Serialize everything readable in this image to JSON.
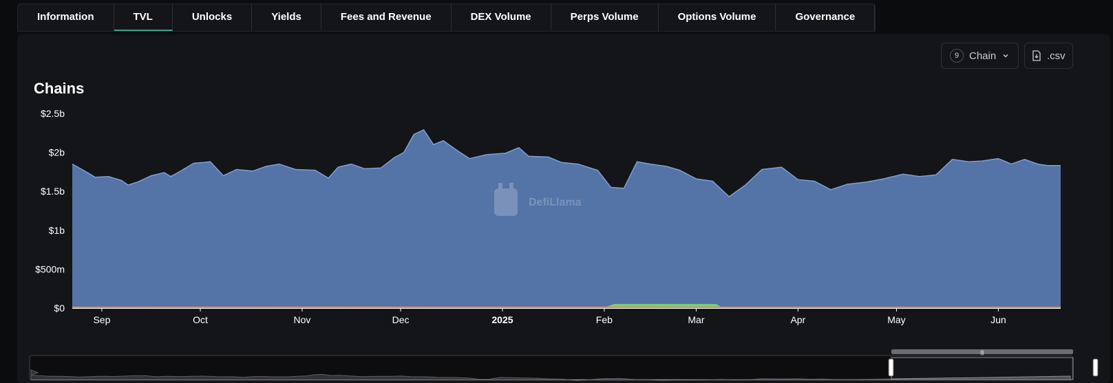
{
  "tabs": [
    {
      "label": "Information",
      "active": false
    },
    {
      "label": "TVL",
      "active": true
    },
    {
      "label": "Unlocks",
      "active": false
    },
    {
      "label": "Yields",
      "active": false
    },
    {
      "label": "Fees and Revenue",
      "active": false
    },
    {
      "label": "DEX Volume",
      "active": false
    },
    {
      "label": "Perps Volume",
      "active": false
    },
    {
      "label": "Options Volume",
      "active": false
    },
    {
      "label": "Governance",
      "active": false
    }
  ],
  "controls": {
    "chain_count": "9",
    "chain_label": "Chain",
    "csv_label": ".csv"
  },
  "watermark": "DefiLlama",
  "chart_data": {
    "type": "area",
    "title": "Chains",
    "stacked": true,
    "ylim": [
      0,
      2500000000
    ],
    "y_ticks": [
      {
        "value": 0,
        "label": "$0"
      },
      {
        "value": 500000000,
        "label": "$500m"
      },
      {
        "value": 1000000000,
        "label": "$1b"
      },
      {
        "value": 1500000000,
        "label": "$1.5b"
      },
      {
        "value": 2000000000,
        "label": "$2b"
      },
      {
        "value": 2500000000,
        "label": "$2.5b"
      }
    ],
    "x_range": [
      "2024-08-23",
      "2025-06-20"
    ],
    "x_ticks": [
      {
        "date": "2024-09-01",
        "label": "Sep",
        "bold": false
      },
      {
        "date": "2024-10-01",
        "label": "Oct",
        "bold": false
      },
      {
        "date": "2024-11-01",
        "label": "Nov",
        "bold": false
      },
      {
        "date": "2024-12-01",
        "label": "Dec",
        "bold": false
      },
      {
        "date": "2025-01-01",
        "label": "2025",
        "bold": true
      },
      {
        "date": "2025-02-01",
        "label": "Feb",
        "bold": false
      },
      {
        "date": "2025-03-01",
        "label": "Mar",
        "bold": false
      },
      {
        "date": "2025-04-01",
        "label": "Apr",
        "bold": false
      },
      {
        "date": "2025-05-01",
        "label": "May",
        "bold": false
      },
      {
        "date": "2025-06-01",
        "label": "Jun",
        "bold": false
      }
    ],
    "grid": false,
    "legend": "none",
    "series": [
      {
        "color": "#5a7cb4",
        "points": [
          [
            "2024-08-23",
            1850000000
          ],
          [
            "2024-08-26",
            1780000000
          ],
          [
            "2024-08-30",
            1680000000
          ],
          [
            "2024-09-03",
            1690000000
          ],
          [
            "2024-09-07",
            1640000000
          ],
          [
            "2024-09-09",
            1580000000
          ],
          [
            "2024-09-12",
            1620000000
          ],
          [
            "2024-09-16",
            1700000000
          ],
          [
            "2024-09-20",
            1740000000
          ],
          [
            "2024-09-22",
            1690000000
          ],
          [
            "2024-09-25",
            1760000000
          ],
          [
            "2024-09-29",
            1860000000
          ],
          [
            "2024-10-02",
            1870000000
          ],
          [
            "2024-10-04",
            1880000000
          ],
          [
            "2024-10-08",
            1700000000
          ],
          [
            "2024-10-12",
            1780000000
          ],
          [
            "2024-10-17",
            1760000000
          ],
          [
            "2024-10-21",
            1820000000
          ],
          [
            "2024-10-25",
            1850000000
          ],
          [
            "2024-10-30",
            1780000000
          ],
          [
            "2024-11-05",
            1770000000
          ],
          [
            "2024-11-09",
            1670000000
          ],
          [
            "2024-11-12",
            1810000000
          ],
          [
            "2024-11-16",
            1850000000
          ],
          [
            "2024-11-20",
            1790000000
          ],
          [
            "2024-11-25",
            1800000000
          ],
          [
            "2024-11-29",
            1930000000
          ],
          [
            "2024-12-02",
            2000000000
          ],
          [
            "2024-12-05",
            2230000000
          ],
          [
            "2024-12-08",
            2290000000
          ],
          [
            "2024-12-11",
            2100000000
          ],
          [
            "2024-12-14",
            2150000000
          ],
          [
            "2024-12-18",
            2030000000
          ],
          [
            "2024-12-22",
            1920000000
          ],
          [
            "2024-12-27",
            1970000000
          ],
          [
            "2025-01-02",
            1990000000
          ],
          [
            "2025-01-06",
            2060000000
          ],
          [
            "2025-01-09",
            1950000000
          ],
          [
            "2025-01-15",
            1940000000
          ],
          [
            "2025-01-19",
            1870000000
          ],
          [
            "2025-01-24",
            1850000000
          ],
          [
            "2025-01-30",
            1770000000
          ],
          [
            "2025-02-03",
            1550000000
          ],
          [
            "2025-02-07",
            1540000000
          ],
          [
            "2025-02-11",
            1880000000
          ],
          [
            "2025-02-15",
            1850000000
          ],
          [
            "2025-02-20",
            1820000000
          ],
          [
            "2025-02-24",
            1770000000
          ],
          [
            "2025-03-01",
            1660000000
          ],
          [
            "2025-03-06",
            1630000000
          ],
          [
            "2025-03-11",
            1430000000
          ],
          [
            "2025-03-16",
            1580000000
          ],
          [
            "2025-03-21",
            1780000000
          ],
          [
            "2025-03-27",
            1810000000
          ],
          [
            "2025-04-01",
            1650000000
          ],
          [
            "2025-04-06",
            1630000000
          ],
          [
            "2025-04-11",
            1520000000
          ],
          [
            "2025-04-16",
            1590000000
          ],
          [
            "2025-04-22",
            1620000000
          ],
          [
            "2025-04-27",
            1660000000
          ],
          [
            "2025-05-03",
            1720000000
          ],
          [
            "2025-05-08",
            1690000000
          ],
          [
            "2025-05-13",
            1710000000
          ],
          [
            "2025-05-18",
            1910000000
          ],
          [
            "2025-05-23",
            1880000000
          ],
          [
            "2025-05-27",
            1890000000
          ],
          [
            "2025-06-01",
            1920000000
          ],
          [
            "2025-06-05",
            1850000000
          ],
          [
            "2025-06-09",
            1910000000
          ],
          [
            "2025-06-13",
            1850000000
          ],
          [
            "2025-06-16",
            1830000000
          ],
          [
            "2025-06-20",
            1830000000
          ]
        ]
      },
      {
        "color": "#7ad37a",
        "points": [
          [
            "2024-08-23",
            0
          ],
          [
            "2025-02-01",
            0
          ],
          [
            "2025-02-04",
            45000000
          ],
          [
            "2025-03-07",
            45000000
          ],
          [
            "2025-03-09",
            0
          ],
          [
            "2025-06-20",
            0
          ]
        ]
      },
      {
        "color": "#e0855a",
        "points": [
          [
            "2024-08-23",
            12000000
          ],
          [
            "2024-11-15",
            14000000
          ],
          [
            "2025-03-10",
            12000000
          ],
          [
            "2025-06-20",
            12000000
          ]
        ]
      }
    ]
  }
}
